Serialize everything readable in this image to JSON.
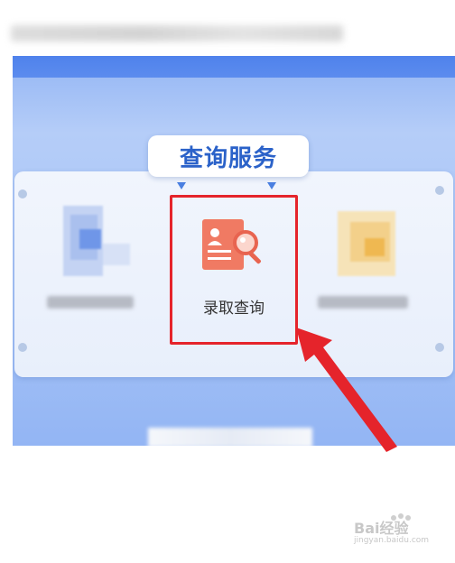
{
  "panel": {
    "title": "查询服务",
    "feature": {
      "label": "录取查询",
      "icon": "admission-query-icon"
    }
  },
  "highlight": {
    "color": "#e5242b"
  },
  "watermark": {
    "brand": "Bai经验",
    "site": "jingyan.baidu.com"
  },
  "colors": {
    "title": "#2b62c9",
    "accent_blue": "#4f82ec",
    "icon_orange": "#f07a63"
  }
}
